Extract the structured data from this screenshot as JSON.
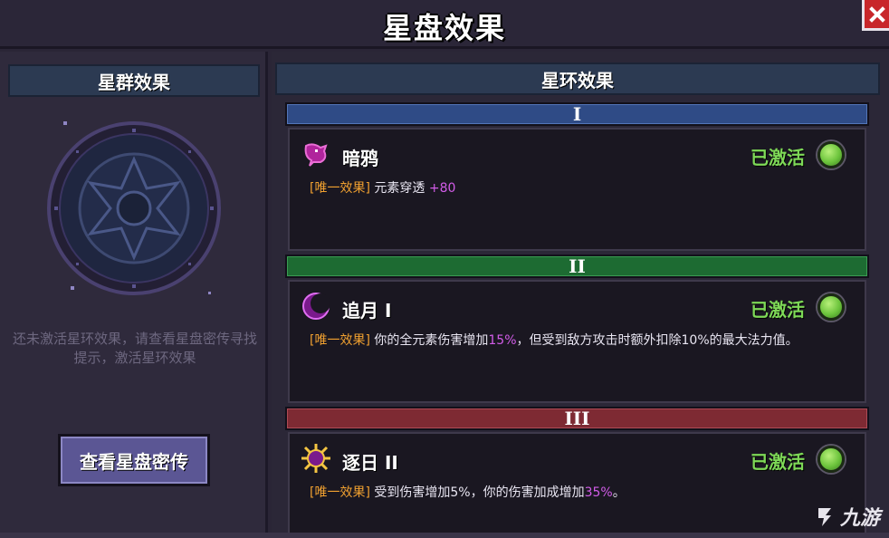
{
  "window": {
    "title": "星盘效果"
  },
  "left": {
    "header": "星群效果",
    "hint": "还未激活星环效果，请查看星盘密传寻找提示，激活星环效果",
    "view_button": "查看星盘密传"
  },
  "right": {
    "header": "星环效果",
    "tiers": [
      {
        "numeral": "I",
        "color": "#2f4b86",
        "name": "暗鸦",
        "icon": "crow-icon",
        "status": "已激活",
        "tag": "[唯一效果]",
        "desc_parts": [
          {
            "text": " 元素穿透 "
          },
          {
            "text": "+80",
            "hl": true
          }
        ]
      },
      {
        "numeral": "II",
        "color": "#1d6b32",
        "name": "追月 I",
        "icon": "moon-icon",
        "status": "已激活",
        "tag": "[唯一效果]",
        "desc_parts": [
          {
            "text": " 你的全元素伤害增加"
          },
          {
            "text": "15%",
            "hl": true
          },
          {
            "text": "，但受到敌方攻击时额外扣除10%的最大法力值。"
          }
        ]
      },
      {
        "numeral": "III",
        "color": "#7e2a33",
        "name": "逐日 II",
        "icon": "sun-icon",
        "status": "已激活",
        "tag": "[唯一效果]",
        "desc_parts": [
          {
            "text": " 受到伤害增加5%，你的伤害加成增加"
          },
          {
            "text": "35%",
            "hl": true
          },
          {
            "text": "。"
          }
        ]
      }
    ]
  },
  "watermark": {
    "text": "九游"
  },
  "colors": {
    "status_active": "#7ed957",
    "tag": "#f0a030",
    "highlight": "#d25ce8"
  }
}
